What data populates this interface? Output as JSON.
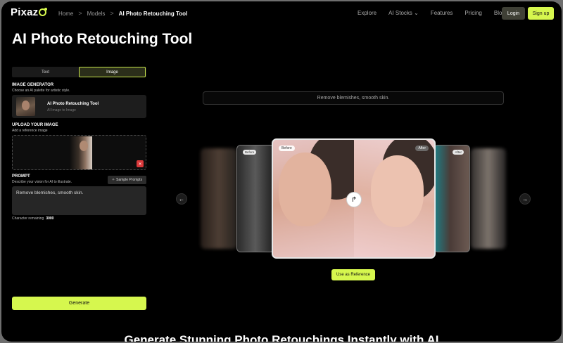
{
  "header": {
    "logo_text": "Pixaz",
    "breadcrumbs": [
      "Home",
      "Models",
      "AI Photo Retouching Tool"
    ],
    "separator": ">",
    "menu": [
      "Explore",
      "AI Stocks ⌄",
      "Features",
      "Pricing",
      "Blogs"
    ],
    "login_label": "Login",
    "signup_label": "Sign up"
  },
  "page_title": "AI Photo Retouching Tool",
  "tabs": [
    "Text",
    "Image"
  ],
  "active_tab": "Image",
  "image_generator": {
    "heading": "IMAGE GENERATOR",
    "subheading": "Choose an AI palette for artistic style.",
    "model_name": "AI Photo Retouching Tool",
    "model_sub": "AI Image to Image"
  },
  "upload": {
    "heading": "UPLOAD YOUR IMAGE",
    "subheading": "Add a reference image",
    "trash_icon": "trash-icon"
  },
  "prompt": {
    "heading": "PROMPT",
    "subheading": "Describe your vision for AI to illustrate.",
    "sample_label": "Sample Prompts",
    "value": "Remove blemishes, smooth skin.",
    "char_label": "Character remaining",
    "char_count": "3000"
  },
  "generate_label": "Generate",
  "preview": {
    "prompt_text": "Remove blemishes, smooth skin.",
    "before_label": "Before",
    "after_label": "After",
    "side_before": "Before",
    "side_after": "After",
    "use_reference_label": "Use as Reference",
    "prev_icon": "←",
    "next_icon": "→",
    "swap_icon": "↱"
  },
  "bottom_heading": "Generate Stunning Photo Retouchings Instantly with AI",
  "colors": {
    "accent": "#d6f74e",
    "background": "#000000",
    "panel": "#1d1d1d"
  }
}
